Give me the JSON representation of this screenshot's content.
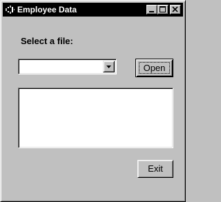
{
  "window": {
    "title": "Employee Data",
    "icon": "app-icon",
    "controls": {
      "minimize_icon": "minimize-icon",
      "maximize_icon": "maximize-icon",
      "close_icon": "close-icon"
    }
  },
  "form": {
    "file_label": "Select a file:",
    "file_select": {
      "value": "",
      "arrow_icon": "chevron-down-icon"
    },
    "open_label": "Open",
    "list_items": [],
    "exit_label": "Exit"
  },
  "colors": {
    "face": "#c0c0c0",
    "titlebar": "#000000",
    "title_text": "#ffffff",
    "field": "#ffffff"
  }
}
